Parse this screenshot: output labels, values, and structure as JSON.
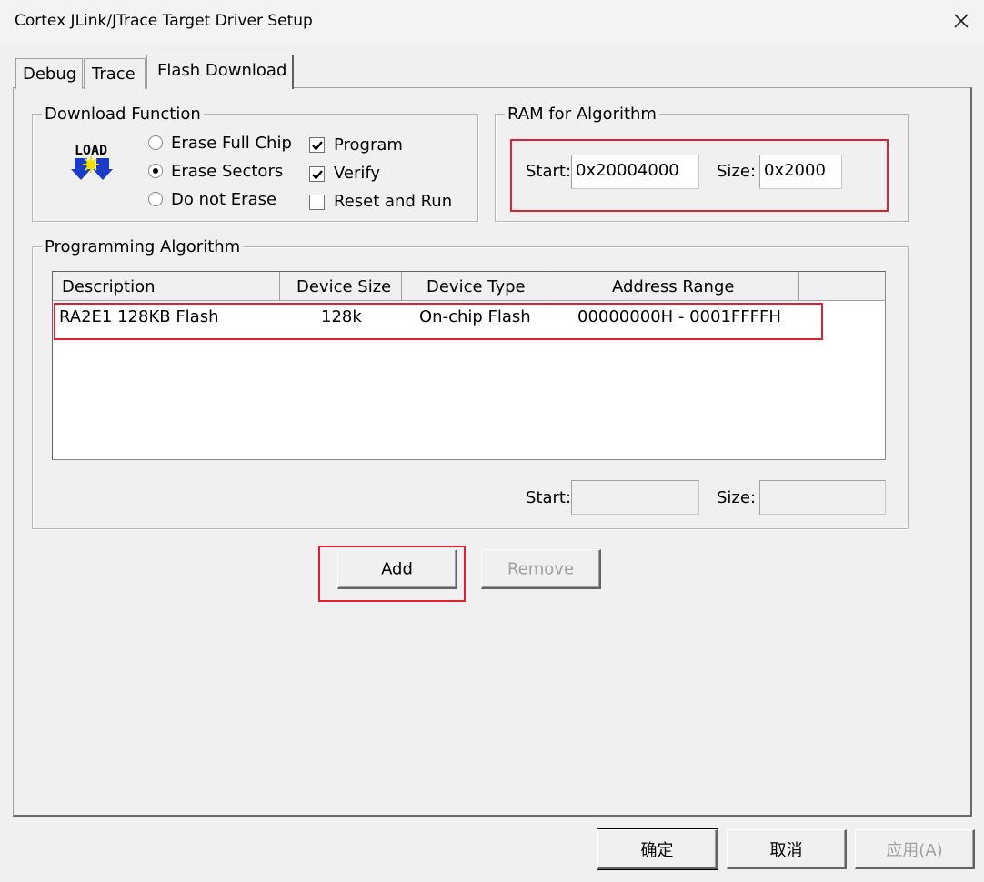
{
  "window": {
    "title": "Cortex JLink/JTrace Target Driver Setup"
  },
  "tabs": [
    {
      "label": "Debug"
    },
    {
      "label": "Trace"
    },
    {
      "label": "Flash Download"
    }
  ],
  "download_function": {
    "legend": "Download Function",
    "logo_text": "LOAD",
    "erase_options": [
      {
        "label": "Erase Full Chip",
        "selected": false
      },
      {
        "label": "Erase Sectors",
        "selected": true
      },
      {
        "label": "Do not Erase",
        "selected": false
      }
    ],
    "checkboxes": [
      {
        "label": "Program",
        "checked": true
      },
      {
        "label": "Verify",
        "checked": true
      },
      {
        "label": "Reset and Run",
        "checked": false
      }
    ]
  },
  "ram_for_algorithm": {
    "legend": "RAM for Algorithm",
    "start_label": "Start:",
    "start_value": "0x20004000",
    "size_label": "Size:",
    "size_value": "0x2000"
  },
  "programming_algorithm": {
    "legend": "Programming Algorithm",
    "columns": [
      "Description",
      "Device Size",
      "Device Type",
      "Address Range"
    ],
    "rows": [
      {
        "description": "RA2E1 128KB Flash",
        "device_size": "128k",
        "device_type": "On-chip Flash",
        "address_range": "00000000H - 0001FFFFH"
      }
    ],
    "start_label": "Start:",
    "start_value": "",
    "size_label": "Size:",
    "size_value": ""
  },
  "buttons": {
    "add": "Add",
    "remove": "Remove",
    "ok": "确定",
    "cancel": "取消",
    "apply": "应用(A)"
  },
  "colors": {
    "highlight_box": "#e02030"
  }
}
